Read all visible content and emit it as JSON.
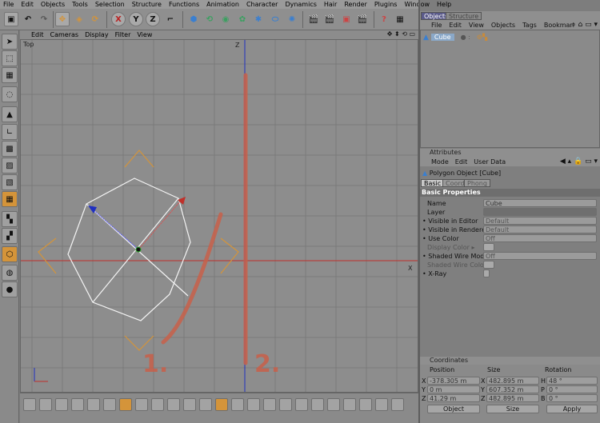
{
  "menubar": [
    "File",
    "Edit",
    "Objects",
    "Tools",
    "Selection",
    "Structure",
    "Functions",
    "Animation",
    "Character",
    "Dynamics",
    "Hair",
    "Render",
    "Plugins",
    "Window",
    "Help"
  ],
  "toolbar": {
    "axis_x": "X",
    "axis_y": "Y",
    "axis_z": "Z"
  },
  "viewport": {
    "menu": [
      "Edit",
      "Cameras",
      "Display",
      "Filter",
      "View"
    ],
    "label": "Top",
    "axis_z_label": "Z",
    "axis_x_label": "X",
    "annotation_1": "1.",
    "annotation_2": "2."
  },
  "objects_manager": {
    "tabs": [
      "Objects",
      "Structure"
    ],
    "menu": [
      "File",
      "Edit",
      "View",
      "Objects",
      "Tags",
      "Bookmarl"
    ],
    "items": [
      {
        "label": "Cube"
      }
    ]
  },
  "attributes": {
    "header": "Attributes",
    "menu": [
      "Mode",
      "Edit",
      "User Data"
    ],
    "object_title": "Polygon Object [Cube]",
    "tabs": [
      "Basic",
      "Coord.",
      "Phong"
    ],
    "section": "Basic Properties",
    "props": [
      {
        "label": "Name",
        "value": "Cube"
      },
      {
        "label": "Layer",
        "value": ""
      },
      {
        "label": "Visible in Editor",
        "value": "Default"
      },
      {
        "label": "Visible in Renderer",
        "value": "Default"
      },
      {
        "label": "Use Color",
        "value": "Off"
      },
      {
        "label": "Display Color",
        "value": ""
      },
      {
        "label": "Shaded Wire Mode",
        "value": "Off"
      },
      {
        "label": "Shaded Wire Color",
        "value": ""
      },
      {
        "label": "X-Ray",
        "value": ""
      }
    ]
  },
  "coordinates": {
    "header": "Coordinates",
    "columns": [
      "Position",
      "Size",
      "Rotation"
    ],
    "rows": [
      {
        "axis": "X",
        "pos": "-378.305 m",
        "size_axis": "X",
        "size": "482.895 m",
        "rot_axis": "H",
        "rot": "48 °"
      },
      {
        "axis": "Y",
        "pos": "0 m",
        "size_axis": "Y",
        "size": "607.352 m",
        "rot_axis": "P",
        "rot": "0 °"
      },
      {
        "axis": "Z",
        "pos": "41.29 m",
        "size_axis": "Z",
        "size": "482.895 m",
        "rot_axis": "B",
        "rot": "0 °"
      }
    ],
    "mode_left": "Object",
    "mode_mid": "Size",
    "apply_label": "Apply"
  },
  "colors": {
    "accent_orange": "#d4943a",
    "axis_red": "#c0302a",
    "axis_blue": "#2030c0",
    "annotation": "#c8604a"
  }
}
